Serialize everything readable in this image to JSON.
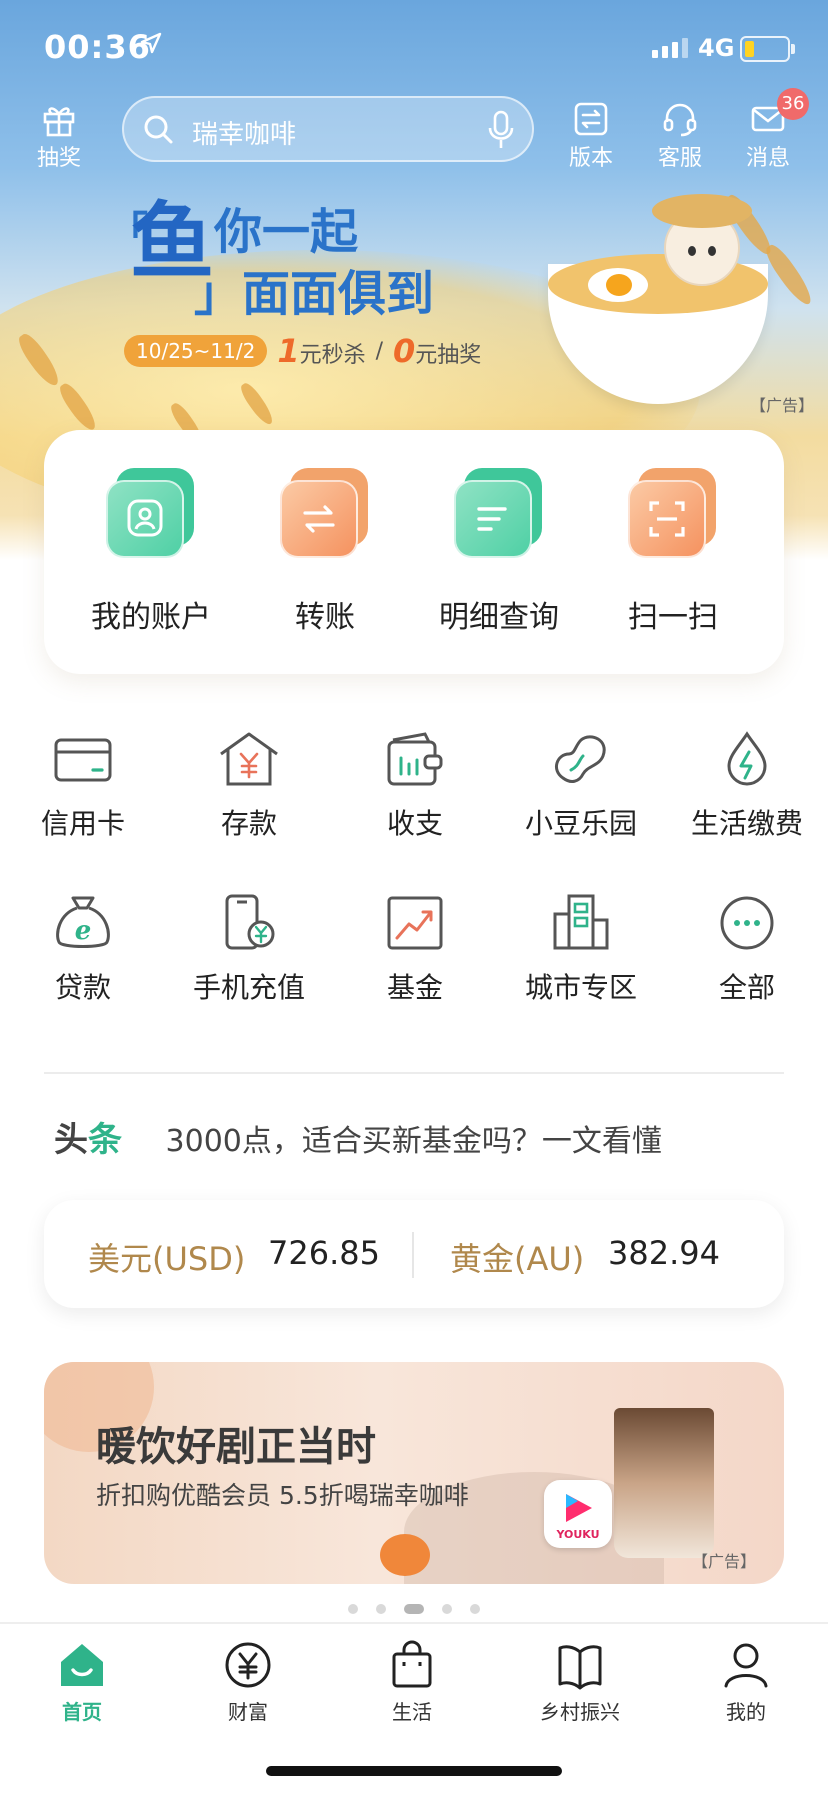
{
  "status_bar": {
    "time": "00:36",
    "network": "4G"
  },
  "top_nav": {
    "lottery_label": "抽奖",
    "search_placeholder": "瑞幸咖啡",
    "version_label": "版本",
    "service_label": "客服",
    "messages_label": "消息",
    "messages_badge": "36"
  },
  "banner": {
    "title_big": "鱼",
    "title_line1": "你一起",
    "title_line2": "面面俱到",
    "date_range": "10/25~11/2",
    "promo_num1": "1",
    "promo_text1": "元秒杀",
    "separator": "/",
    "promo_num2": "0",
    "promo_text2": "元抽奖",
    "ad_tag": "【广告】"
  },
  "quick_actions": [
    {
      "label": "我的账户",
      "icon": "person-icon",
      "color": "green"
    },
    {
      "label": "转账",
      "icon": "transfer-icon",
      "color": "orange"
    },
    {
      "label": "明细查询",
      "icon": "details-icon",
      "color": "green"
    },
    {
      "label": "扫一扫",
      "icon": "scan-icon",
      "color": "orange"
    }
  ],
  "services": [
    {
      "label": "信用卡",
      "icon": "credit-card-icon"
    },
    {
      "label": "存款",
      "icon": "deposit-house-icon"
    },
    {
      "label": "收支",
      "icon": "wallet-icon"
    },
    {
      "label": "小豆乐园",
      "icon": "bean-icon"
    },
    {
      "label": "生活缴费",
      "icon": "utility-drop-icon"
    },
    {
      "label": "贷款",
      "icon": "loan-bag-icon"
    },
    {
      "label": "手机充值",
      "icon": "phone-topup-icon"
    },
    {
      "label": "基金",
      "icon": "fund-chart-icon"
    },
    {
      "label": "城市专区",
      "icon": "city-buildings-icon"
    },
    {
      "label": "全部",
      "icon": "more-icon"
    }
  ],
  "headline": {
    "tag_part1": "头",
    "tag_part2": "条",
    "text": "3000点，适合买新基金吗？一文看懂"
  },
  "rates": [
    {
      "label": "美元(USD)",
      "value": "726.85"
    },
    {
      "label": "黄金(AU)",
      "value": "382.94"
    }
  ],
  "promo": {
    "title": "暖饮好剧正当时",
    "subtitle": "折扣购优酷会员 5.5折喝瑞幸咖啡",
    "brand": "YOUKU",
    "ad_tag": "【广告】"
  },
  "carousel": {
    "total": 5,
    "active_index": 2
  },
  "tab_bar": [
    {
      "label": "首页",
      "icon": "home-icon",
      "active": true
    },
    {
      "label": "财富",
      "icon": "yuan-icon",
      "active": false
    },
    {
      "label": "生活",
      "icon": "shopping-bag-icon",
      "active": false
    },
    {
      "label": "乡村振兴",
      "icon": "book-icon",
      "active": false
    },
    {
      "label": "我的",
      "icon": "profile-icon",
      "active": false
    }
  ],
  "colors": {
    "accent_green": "#2fb38a",
    "accent_orange": "#f0873a",
    "banner_blue": "#2a73c9",
    "gold_label": "#b0884c"
  }
}
